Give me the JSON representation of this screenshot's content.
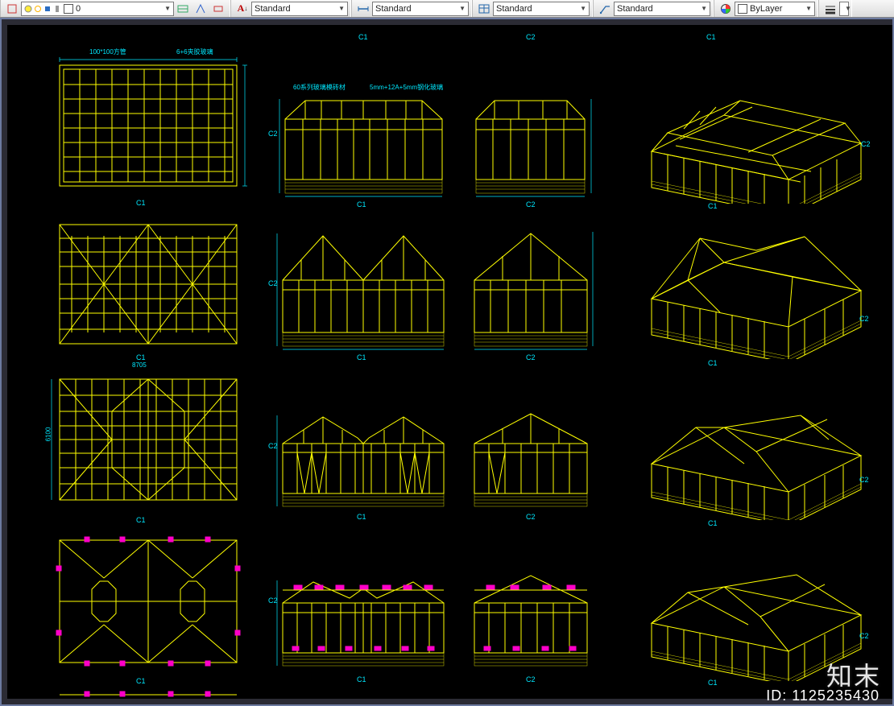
{
  "toolbar": {
    "layer_value": "0",
    "text_style": "Standard",
    "dim_style": "Standard",
    "table_style": "Standard",
    "mleader_style": "Standard",
    "color": "ByLayer"
  },
  "annotations": {
    "note1": "100*100方管",
    "note2": "6+6夹胶玻璃",
    "note3": "60系列玻璃模砖材",
    "note4": "5mm+12A+5mm钢化玻璃",
    "dim_8705": "8705",
    "dim_6100": "6100"
  },
  "labels": {
    "C1": "C1",
    "C2": "C2"
  },
  "watermark": "知末",
  "id": "ID: 1125235430"
}
